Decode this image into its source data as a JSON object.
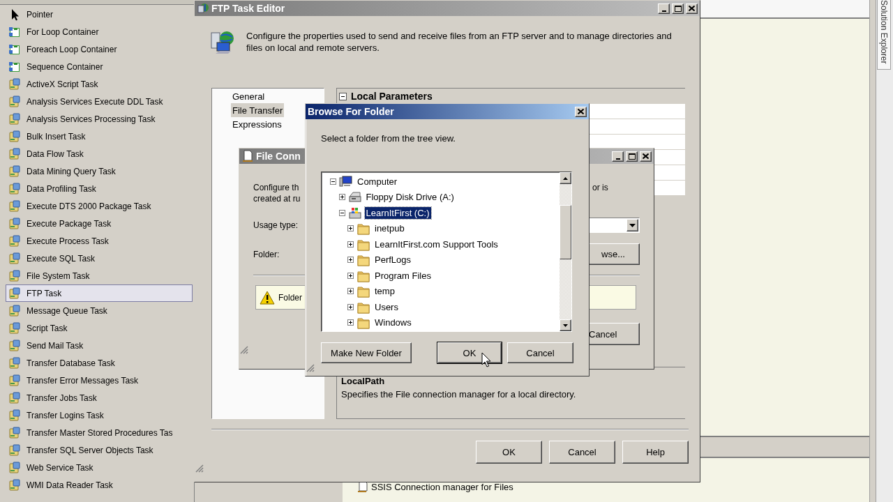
{
  "toolbox": {
    "items": [
      {
        "label": "Pointer",
        "kind": "pointer",
        "selected": false
      },
      {
        "label": "For Loop Container",
        "kind": "container",
        "selected": false
      },
      {
        "label": "Foreach Loop Container",
        "kind": "container",
        "selected": false
      },
      {
        "label": "Sequence Container",
        "kind": "container",
        "selected": false
      },
      {
        "label": "ActiveX Script Task",
        "kind": "task",
        "selected": false
      },
      {
        "label": "Analysis Services Execute DDL Task",
        "kind": "task",
        "selected": false
      },
      {
        "label": "Analysis Services Processing Task",
        "kind": "task",
        "selected": false
      },
      {
        "label": "Bulk Insert Task",
        "kind": "task",
        "selected": false
      },
      {
        "label": "Data Flow Task",
        "kind": "task",
        "selected": false
      },
      {
        "label": "Data Mining Query Task",
        "kind": "task",
        "selected": false
      },
      {
        "label": "Data Profiling Task",
        "kind": "task",
        "selected": false
      },
      {
        "label": "Execute DTS 2000 Package Task",
        "kind": "task",
        "selected": false
      },
      {
        "label": "Execute Package Task",
        "kind": "task",
        "selected": false
      },
      {
        "label": "Execute Process Task",
        "kind": "task",
        "selected": false
      },
      {
        "label": "Execute SQL Task",
        "kind": "task",
        "selected": false
      },
      {
        "label": "File System Task",
        "kind": "task",
        "selected": false
      },
      {
        "label": "FTP Task",
        "kind": "task",
        "selected": true
      },
      {
        "label": "Message Queue Task",
        "kind": "task",
        "selected": false
      },
      {
        "label": "Script Task",
        "kind": "task",
        "selected": false
      },
      {
        "label": "Send Mail Task",
        "kind": "task",
        "selected": false
      },
      {
        "label": "Transfer Database Task",
        "kind": "task",
        "selected": false
      },
      {
        "label": "Transfer Error Messages Task",
        "kind": "task",
        "selected": false
      },
      {
        "label": "Transfer Jobs Task",
        "kind": "task",
        "selected": false
      },
      {
        "label": "Transfer Logins Task",
        "kind": "task",
        "selected": false
      },
      {
        "label": "Transfer Master Stored Procedures Tas",
        "kind": "task",
        "selected": false
      },
      {
        "label": "Transfer SQL Server Objects Task",
        "kind": "task",
        "selected": false
      },
      {
        "label": "Web Service Task",
        "kind": "task",
        "selected": false
      },
      {
        "label": "WMI Data Reader Task",
        "kind": "task",
        "selected": false
      }
    ]
  },
  "ftp_task_editor": {
    "title": "FTP Task Editor",
    "description": "Configure the properties used to send and receive files from an FTP server and to manage directories and files on local and remote servers.",
    "pages": [
      {
        "label": "General",
        "selected": false
      },
      {
        "label": "File Transfer",
        "selected": true
      },
      {
        "label": "Expressions",
        "selected": false
      }
    ],
    "property_grid": {
      "category": "Local Parameters",
      "expanded": true
    },
    "help": {
      "title": "LocalPath",
      "text": "Specifies the File connection manager for a local directory."
    },
    "buttons": [
      "OK",
      "Cancel",
      "Help"
    ]
  },
  "file_connection_manager_editor": {
    "title": "File Conn",
    "description_lines": [
      "Configure th",
      "created at ru"
    ],
    "description_end": "or is",
    "usage_type_label": "Usage type:",
    "folder_label": "Folder:",
    "browse_button": "wse...",
    "warning": "Folder",
    "cancel_button": "Cancel"
  },
  "browse_for_folder": {
    "title": "Browse For Folder",
    "instruction": "Select a folder from the tree view.",
    "tree": [
      {
        "label": "Computer",
        "kind": "computer",
        "expanded": true,
        "selected": false,
        "children": [
          {
            "label": "Floppy Disk Drive (A:)",
            "kind": "floppy",
            "expanded": false,
            "selected": false
          },
          {
            "label": "LearnItFirst (C:)",
            "kind": "drive",
            "expanded": true,
            "selected": true,
            "children": [
              {
                "label": "inetpub",
                "kind": "folder",
                "expanded": false,
                "selected": false
              },
              {
                "label": "LearnItFirst.com Support Tools",
                "kind": "folder",
                "expanded": false,
                "selected": false
              },
              {
                "label": "PerfLogs",
                "kind": "folder",
                "expanded": false,
                "selected": false
              },
              {
                "label": "Program Files",
                "kind": "folder",
                "expanded": false,
                "selected": false
              },
              {
                "label": "temp",
                "kind": "folder",
                "expanded": false,
                "selected": false
              },
              {
                "label": "Users",
                "kind": "folder",
                "expanded": false,
                "selected": false
              },
              {
                "label": "Windows",
                "kind": "folder",
                "expanded": false,
                "selected": false
              }
            ]
          }
        ]
      }
    ],
    "buttons": [
      {
        "label": "Make New Folder",
        "default": false
      },
      {
        "label": "OK",
        "default": true
      },
      {
        "label": "Cancel",
        "default": false
      }
    ]
  },
  "connection_managers": {
    "items": [
      "SSIS Connection manager for Files"
    ]
  },
  "solution_explorer_tab": "Solution Explorer"
}
